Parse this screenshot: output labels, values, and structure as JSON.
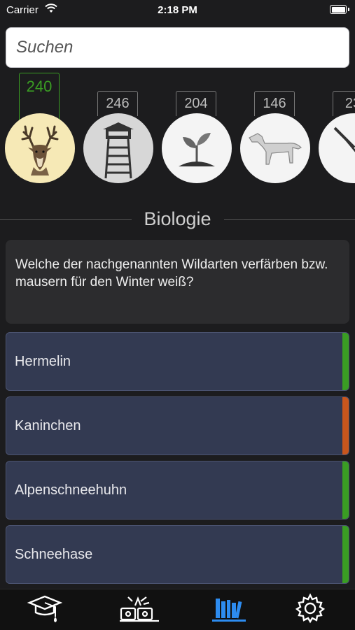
{
  "status_bar": {
    "carrier": "Carrier",
    "time": "2:18 PM"
  },
  "search": {
    "placeholder": "Suchen"
  },
  "categories": [
    {
      "count": "240",
      "icon": "deer-icon",
      "active": true
    },
    {
      "count": "246",
      "icon": "watchtower-icon",
      "active": false
    },
    {
      "count": "204",
      "icon": "plant-icon",
      "active": false
    },
    {
      "count": "146",
      "icon": "hunting-dog-icon",
      "active": false
    },
    {
      "count": "23",
      "icon": "rifle-icon",
      "active": false
    }
  ],
  "section_title": "Biologie",
  "question": "Welche der nachgenannten Wildarten verfärben bzw. mausern für den Winter weiß?",
  "answers": [
    {
      "label": "Hermelin",
      "status_color": "#3a9d23"
    },
    {
      "label": "Kaninchen",
      "status_color": "#c8561d"
    },
    {
      "label": "Alpenschneehuhn",
      "status_color": "#3a9d23"
    },
    {
      "label": "Schneehase",
      "status_color": "#3a9d23"
    }
  ],
  "tabbar": {
    "tabs": [
      {
        "icon": "graduation-cap-icon"
      },
      {
        "icon": "exam-icon"
      },
      {
        "icon": "library-icon",
        "selected": true
      },
      {
        "icon": "gear-icon"
      }
    ],
    "accent": "#2d8cf0"
  }
}
